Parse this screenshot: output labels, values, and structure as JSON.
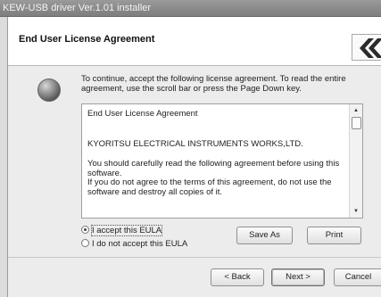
{
  "window": {
    "title": "KEW-USB driver Ver.1.01 installer"
  },
  "header": {
    "title": "End User License Agreement",
    "logo_icon": "kyoritsu-logo-icon"
  },
  "instruction": "To continue, accept the following license agreement. To read the entire agreement, use the scroll bar or press the Page Down key.",
  "eula": {
    "heading": "End User License Agreement",
    "company": "KYORITSU ELECTRICAL INSTRUMENTS WORKS,LTD.",
    "paragraph1": "You should carefully read the following agreement before using this software.",
    "paragraph2": "If you do not agree to the terms of this agreement, do not use the software and destroy all copies of it."
  },
  "options": {
    "accept_label": "I accept this EULA",
    "decline_label": "I do not accept this EULA",
    "selected": "accept"
  },
  "buttons": {
    "save_as": "Save As",
    "print": "Print",
    "back": "< Back",
    "next": "Next >",
    "cancel": "Cancel"
  }
}
